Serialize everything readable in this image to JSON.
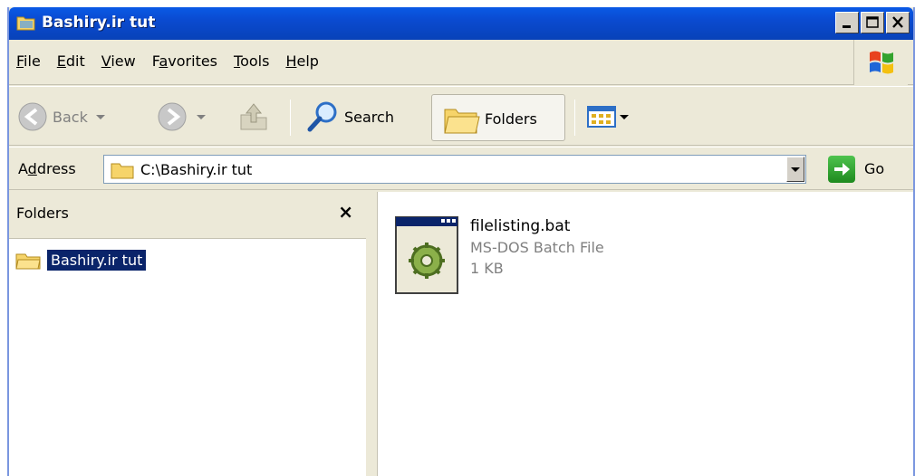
{
  "window": {
    "title": "Bashiry.ir tut",
    "title_icon": "folder-icon",
    "controls": [
      "minimize-icon",
      "maximize-icon",
      "close-icon"
    ]
  },
  "menu": {
    "items": [
      {
        "pre": "",
        "key": "F",
        "post": "ile"
      },
      {
        "pre": "",
        "key": "E",
        "post": "dit"
      },
      {
        "pre": "",
        "key": "V",
        "post": "iew"
      },
      {
        "pre": "F",
        "key": "a",
        "post": "vorites"
      },
      {
        "pre": "",
        "key": "T",
        "post": "ools"
      },
      {
        "pre": "",
        "key": "H",
        "post": "elp"
      }
    ]
  },
  "toolbar": {
    "back_label": "Back",
    "search_label": "Search",
    "folders_label": "Folders"
  },
  "address": {
    "label_pre": "A",
    "label_key": "d",
    "label_post": "dress",
    "value": "C:\\Bashiry.ir tut",
    "go_label": "Go"
  },
  "folders_pane": {
    "title": "Folders",
    "close_glyph": "×",
    "tree": [
      {
        "label": "Bashiry.ir tut",
        "selected": true
      }
    ]
  },
  "files": [
    {
      "name": "filelisting.bat",
      "type": "MS-DOS Batch File",
      "size": "1 KB",
      "icon": "batch-file-icon"
    }
  ],
  "colors": {
    "titlebar": "#0a4ad0",
    "chrome": "#ece9d8",
    "selection": "#0a246a",
    "folder": "#f6d46a"
  }
}
